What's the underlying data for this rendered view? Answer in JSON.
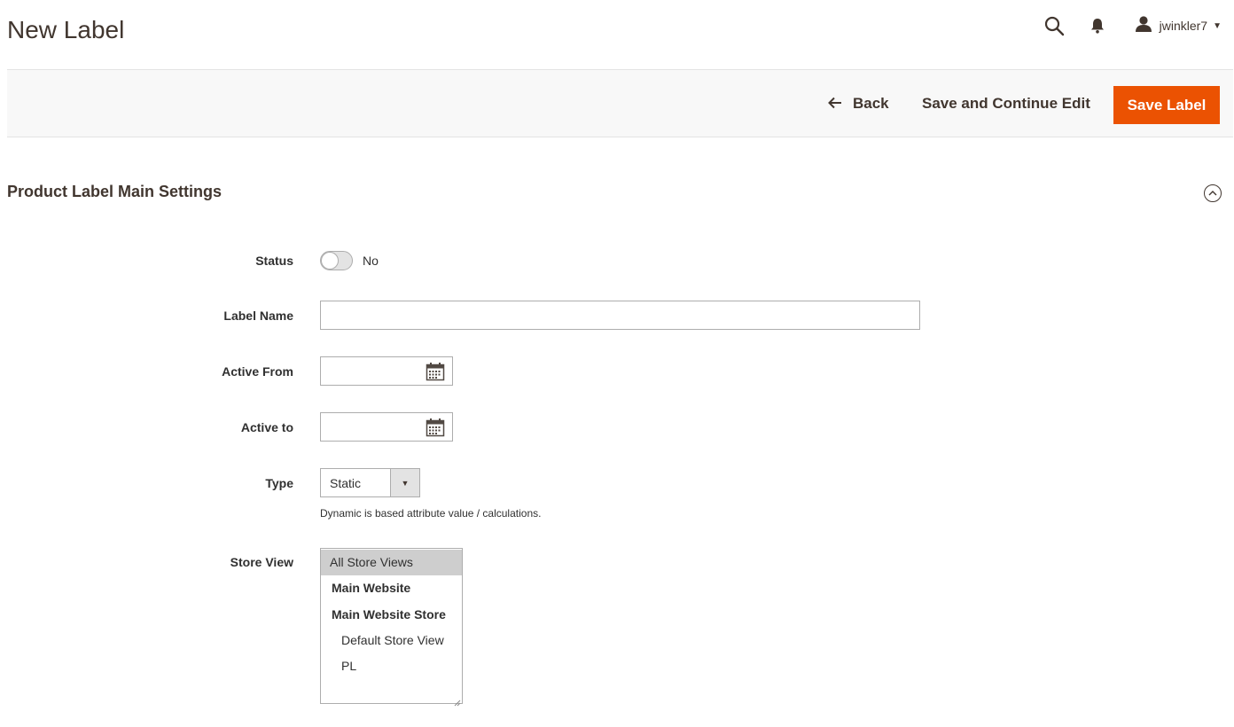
{
  "header": {
    "title": "New Label",
    "username": "jwinkler7",
    "icons": {
      "search": "search-icon",
      "notifications": "bell-icon",
      "user": "user-icon"
    }
  },
  "actions": {
    "back_label": "Back",
    "save_continue_label": "Save and Continue Edit",
    "save_label": "Save Label",
    "accent_color": "#eb5202"
  },
  "section": {
    "title": "Product Label Main Settings"
  },
  "form": {
    "status": {
      "label": "Status",
      "value_text": "No",
      "enabled": false
    },
    "label_name": {
      "label": "Label Name",
      "value": "",
      "placeholder": ""
    },
    "active_from": {
      "label": "Active From",
      "value": ""
    },
    "active_to": {
      "label": "Active to",
      "value": ""
    },
    "type": {
      "label": "Type",
      "selected": "Static",
      "note": "Dynamic is based attribute value / calculations."
    },
    "store_view": {
      "label": "Store View",
      "options": [
        {
          "text": "All Store Views",
          "selected": true,
          "kind": "option"
        },
        {
          "text": "Main Website",
          "kind": "group"
        },
        {
          "text": "Main Website Store",
          "kind": "group"
        },
        {
          "text": "Default Store View",
          "kind": "option"
        },
        {
          "text": "PL",
          "kind": "option"
        }
      ]
    }
  }
}
